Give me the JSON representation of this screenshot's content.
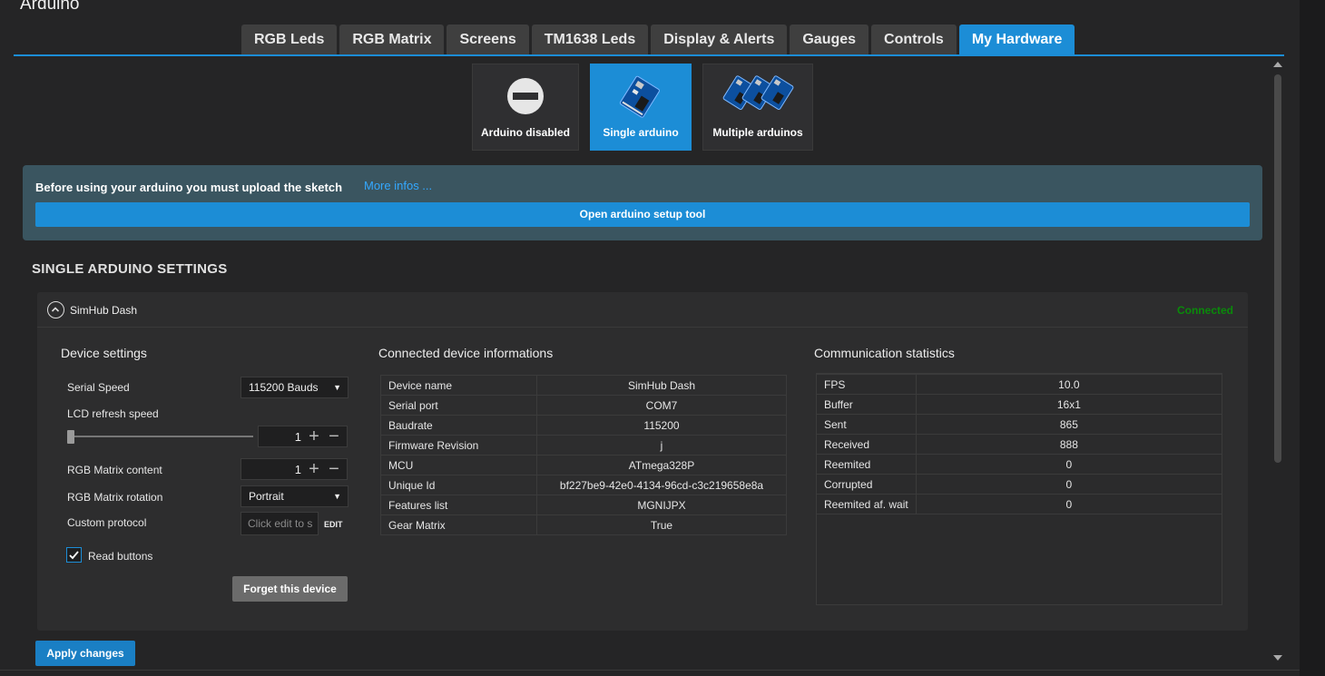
{
  "app": {
    "title": "Arduino"
  },
  "tabs": [
    "RGB Leds",
    "RGB Matrix",
    "Screens",
    "TM1638 Leds",
    "Display & Alerts",
    "Gauges",
    "Controls",
    "My Hardware"
  ],
  "active_tab": "My Hardware",
  "modes": [
    {
      "label": "Arduino disabled",
      "icon": "disabled-icon"
    },
    {
      "label": "Single arduino",
      "icon": "arduino-board-icon",
      "active": true
    },
    {
      "label": "Multiple arduinos",
      "icon": "multiple-arduino-boards-icon"
    }
  ],
  "banner": {
    "text": "Before using your arduino you must upload the sketch",
    "link": "More infos ...",
    "button": "Open arduino setup tool"
  },
  "section_title": "SINGLE ARDUINO SETTINGS",
  "device": {
    "name": "SimHub Dash",
    "status": "Connected",
    "settings_title": "Device settings",
    "serial_speed_label": "Serial Speed",
    "serial_speed_value": "115200 Bauds",
    "lcd_refresh_label": "LCD refresh speed",
    "lcd_refresh_value": "1",
    "rgb_matrix_content_label": "RGB Matrix content",
    "rgb_matrix_content_value": "1",
    "rgb_matrix_rotation_label": "RGB Matrix rotation",
    "rgb_matrix_rotation_value": "Portrait",
    "custom_protocol_label": "Custom protocol",
    "custom_protocol_placeholder": "Click edit to s",
    "edit_label": "EDIT",
    "read_buttons_label": "Read buttons",
    "read_buttons_checked": true,
    "forget_button": "Forget this device"
  },
  "device_info": {
    "title": "Connected device informations",
    "rows": [
      [
        "Device name",
        "SimHub Dash"
      ],
      [
        "Serial port",
        "COM7"
      ],
      [
        "Baudrate",
        "115200"
      ],
      [
        "Firmware Revision",
        "j"
      ],
      [
        "MCU",
        "ATmega328P"
      ],
      [
        "Unique Id",
        "bf227be9-42e0-4134-96cd-c3c219658e8a"
      ],
      [
        "Features list",
        "MGNIJPX"
      ],
      [
        "Gear Matrix",
        "True"
      ]
    ]
  },
  "stats": {
    "title": "Communication statistics",
    "rows": [
      [
        "FPS",
        "10.0"
      ],
      [
        "Buffer",
        "16x1"
      ],
      [
        "Sent",
        "865"
      ],
      [
        "Received",
        "888"
      ],
      [
        "Reemited",
        "0"
      ],
      [
        "Corrupted",
        "0"
      ],
      [
        "Reemited af. wait",
        "0"
      ]
    ]
  },
  "apply_button": "Apply changes",
  "colors": {
    "accent": "#1c8dd6",
    "connected": "#0a8a0a",
    "banner": "#3a5560"
  }
}
